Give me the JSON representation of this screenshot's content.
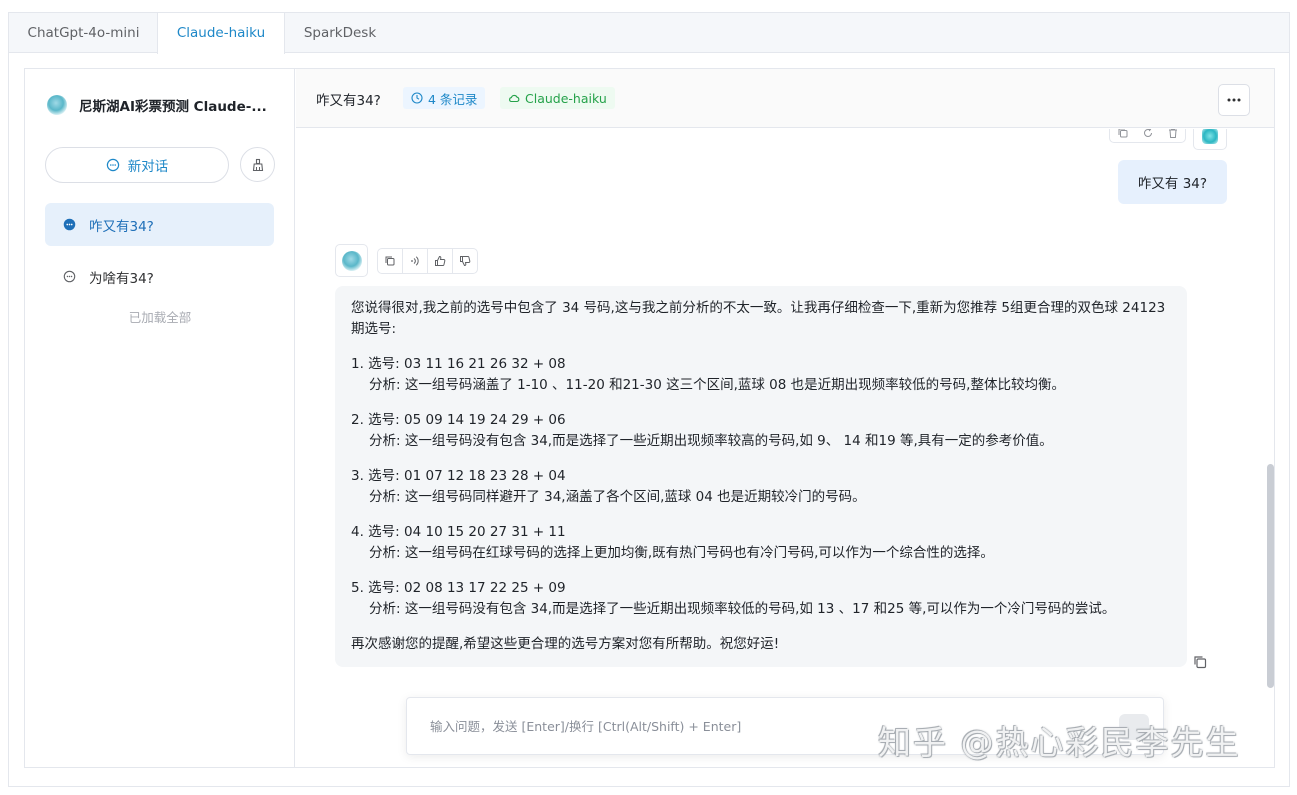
{
  "tabs": [
    {
      "label": "ChatGpt-4o-mini",
      "active": false
    },
    {
      "label": "Claude-haiku",
      "active": true
    },
    {
      "label": "SparkDesk",
      "active": false
    }
  ],
  "sidebar": {
    "title": "尼斯湖AI彩票预测 Claude-...",
    "new_chat_label": "新对话",
    "conversations": [
      {
        "label": "咋又有34?",
        "active": true
      },
      {
        "label": "为啥有34?",
        "active": false
      }
    ],
    "loaded_all": "已加载全部"
  },
  "header": {
    "title": "咋又有34?",
    "records": "4 条记录",
    "model": "Claude-haiku"
  },
  "chat": {
    "user_message": "咋又有 34?",
    "ai": {
      "intro": "您说得很对,我之前的选号中包含了 34 号码,这与我之前分析的不太一致。让我再仔细检查一下,重新为您推荐 5组更合理的双色球 24123 期选号:",
      "items": [
        {
          "pick": "1. 选号: 03 11 16 21 26 32 + 08",
          "analysis": "分析: 这一组号码涵盖了 1-10 、11-20 和21-30 这三个区间,蓝球 08 也是近期出现频率较低的号码,整体比较均衡。"
        },
        {
          "pick": "2. 选号: 05 09 14 19 24 29 + 06",
          "analysis": "分析: 这一组号码没有包含 34,而是选择了一些近期出现频率较高的号码,如 9、 14 和19 等,具有一定的参考价值。"
        },
        {
          "pick": "3. 选号: 01 07 12 18 23 28 + 04",
          "analysis": "分析: 这一组号码同样避开了 34,涵盖了各个区间,蓝球 04 也是近期较冷门的号码。"
        },
        {
          "pick": "4. 选号: 04 10 15 20 27 31 + 11",
          "analysis": "分析: 这一组号码在红球号码的选择上更加均衡,既有热门号码也有冷门号码,可以作为一个综合性的选择。"
        },
        {
          "pick": "5. 选号: 02 08 13 17 22 25 + 09",
          "analysis": "分析: 这一组号码没有包含 34,而是选择了一些近期出现频率较低的号码,如 13 、17 和25 等,可以作为一个冷门号码的尝试。"
        }
      ],
      "outro": "再次感谢您的提醒,希望这些更合理的选号方案对您有所帮助。祝您好运!"
    }
  },
  "input": {
    "value": "",
    "placeholder": "输入问题，发送 [Enter]/换行 [Ctrl(Alt/Shift) + Enter]"
  },
  "watermark": "知乎 @热心彩民李先生",
  "colors": {
    "accent": "#1e88c8",
    "active_bg": "#e6f0fb",
    "user_bubble": "#e6f0fd",
    "ai_bubble": "#f4f6f8",
    "model_tag": "#25a24a"
  }
}
